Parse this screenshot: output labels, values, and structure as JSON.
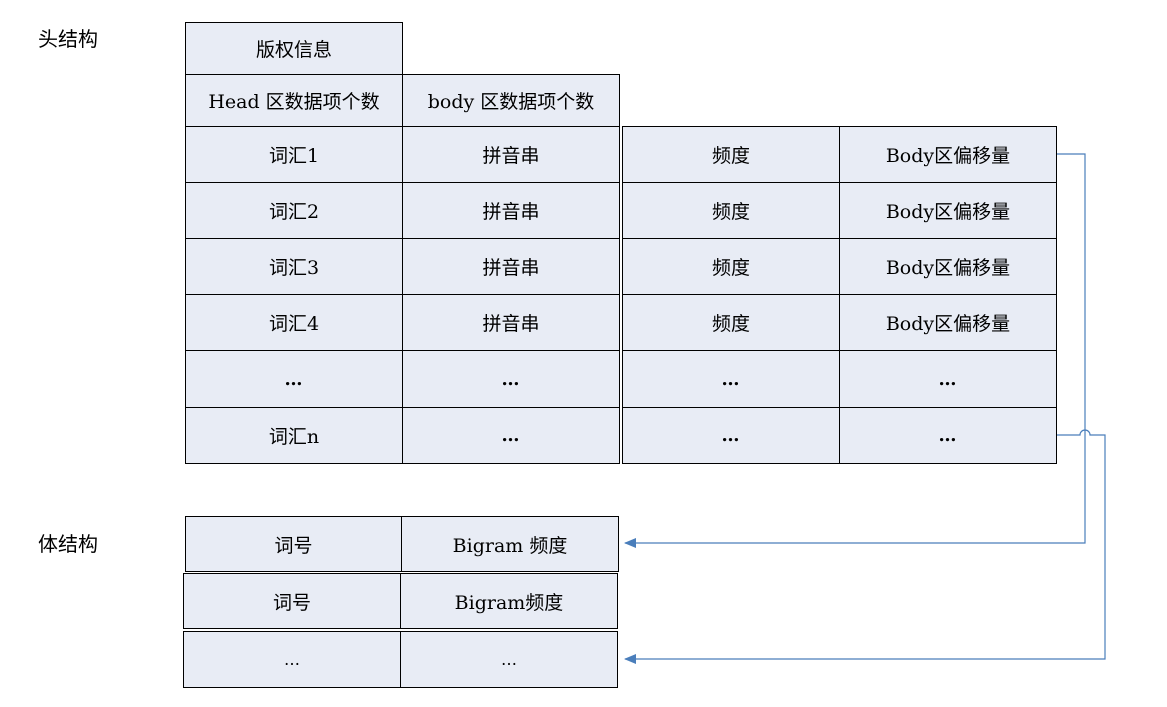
{
  "head": {
    "label": "头结构",
    "copyright": "版权信息",
    "head_count": "Head 区数据项个数",
    "body_count": "body 区数据项个数",
    "rows": [
      [
        "词汇1",
        "拼音串",
        "频度",
        "Body区偏移量"
      ],
      [
        "词汇2",
        "拼音串",
        "频度",
        "Body区偏移量"
      ],
      [
        "词汇3",
        "拼音串",
        "频度",
        "Body区偏移量"
      ],
      [
        "词汇4",
        "拼音串",
        "频度",
        "Body区偏移量"
      ],
      [
        "…",
        "…",
        "…",
        "…"
      ],
      [
        "词汇n",
        "…",
        "…",
        "…"
      ]
    ]
  },
  "body": {
    "label": "体结构",
    "rows": [
      [
        "词号",
        "Bigram 频度"
      ],
      [
        "词号",
        "Bigram频度"
      ],
      [
        "…",
        "…"
      ]
    ]
  },
  "colors": {
    "cell_fill": "#e8ecf5",
    "border": "#000000",
    "arrow": "#4a7ebb"
  }
}
